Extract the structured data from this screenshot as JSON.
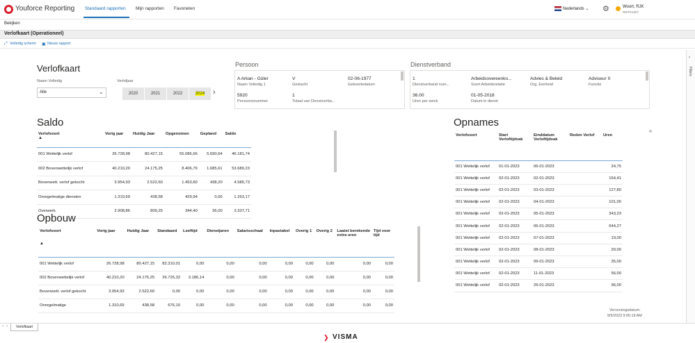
{
  "app": {
    "title": "Youforce Reporting",
    "nav": [
      "Standaard rapporten",
      "Mijn rapporten",
      "Favorieten"
    ],
    "language": "Nederlands",
    "user_name": "Woort, RJK",
    "user_sub": "RWTE1007"
  },
  "menu": {
    "bekijken": "Bekijken"
  },
  "report": {
    "title": "Verlofkaart (Operationeel)",
    "tool_fullscreen": "Volledig scherm",
    "tool_new": "Nieuw rapport",
    "filters": "Filters"
  },
  "verlofkaart": {
    "heading": "Verlofkaart",
    "naam_label": "Naam Volledig",
    "naam_value": "Alle",
    "jaar_label": "Verlofjaar",
    "years": [
      "2020",
      "2021",
      "2022",
      "2024"
    ],
    "selected_year": "2024"
  },
  "persoon": {
    "heading": "Persoon",
    "naam": "A Arkan - Güler",
    "naam_label": "Naam Volledig 1",
    "geslacht": "V",
    "geslacht_label": "Geslacht",
    "geboortedatum": "02-06-1977",
    "geboortedatum_label": "Geboortedatum",
    "persoonsnummer": "5920",
    "persoonsnummer_label": "Persoonsnummer",
    "totaal": "1",
    "totaal_label": "Totaal van Dienstverba..."
  },
  "dienstverband": {
    "heading": "Dienstverband",
    "nummer": "1",
    "nummer_label": "Dienstverband num...",
    "soort": "Arbeidsovereenko...",
    "soort_label": "Soort Arbeidsrelatie",
    "org": "Advies & Beleid",
    "org_label": "Org. Eenheid",
    "functie": "Adviseur II",
    "functie_label": "Functie",
    "uren": "36.00",
    "uren_label": "Uren per week",
    "datum": "01-05-2018",
    "datum_label": "Datum in dienst"
  },
  "saldo": {
    "heading": "Saldo",
    "columns": [
      "Verlofsoort",
      "Vorig jaar",
      "Huidig Jaar",
      "Opgenomen",
      "Gepland",
      "Saldo"
    ],
    "rows": [
      [
        "001 Wettelijk verlof",
        "26.728,98",
        "80.427,15",
        "55.086,66",
        "5.690,64",
        "46.181,74"
      ],
      [
        "002 Bovenwettelijk verlof",
        "40.210,20",
        "24.175,25",
        "8.406,79",
        "1.685,61",
        "53.680,23"
      ],
      [
        "Bovenwett. verlof gekocht",
        "3.954,93",
        "2.522,60",
        "1.453,60",
        "438,20",
        "4.585,73"
      ],
      [
        "Onregelmatige diensten",
        "1.310,69",
        "438,58",
        "429,94",
        "0,00",
        "1.263,17"
      ],
      [
        "Overwerk",
        "2.908,86",
        "809,25",
        "344,40",
        "36,00",
        "3.337,71"
      ]
    ]
  },
  "opbouw": {
    "heading": "Opbouw",
    "columns": [
      "Verlofsoort",
      "Vorig jaar",
      "Huidig Jaar",
      "Standaard",
      "Leeftijd",
      "Dienstjaren",
      "Salarisschaal",
      "Inpastabel",
      "Overig 1",
      "Overig 2",
      "Laatst berekende extra uren",
      "Tijd voor tijd"
    ],
    "rows": [
      [
        "001 Wettelijk verlof",
        "26.728,98",
        "80.427,15",
        "82.310,01",
        "0,00",
        "0,00",
        "0,00",
        "0,00",
        "0,00",
        "0,00",
        "0,00",
        "0,00"
      ],
      [
        "002 Bovenwettelijk verlof",
        "40.210,20",
        "24.175,25",
        "26.725,32",
        "3.186,14",
        "0,00",
        "0,00",
        "0,00",
        "0,00",
        "0,00",
        "0,00",
        "0,00"
      ],
      [
        "Bovenwett. verlof gekocht",
        "3.954,93",
        "2.522,60",
        "0,00",
        "0,00",
        "0,00",
        "0,00",
        "0,00",
        "0,00",
        "0,00",
        "0,00",
        "0,00"
      ],
      [
        "Onregelmatige",
        "1.310,69",
        "438,58",
        "676,10",
        "0,00",
        "0,00",
        "0,00",
        "0,00",
        "0,00",
        "0,00",
        "0,00",
        "0,00"
      ]
    ]
  },
  "opnames": {
    "heading": "Opnames",
    "columns": [
      "Verlofsoort",
      "Start Verloftijdvak",
      "Einddatum Verloftijdvak",
      "Reden Verlof",
      "Uren"
    ],
    "rows": [
      [
        "001 Wettelijk verlof",
        "01-01-2023",
        "06-01-2023",
        "",
        "24,75"
      ],
      [
        "001 Wettelijk verlof",
        "02-01-2023",
        "02-01-2023",
        "",
        "164,41"
      ],
      [
        "001 Wettelijk verlof",
        "02-01-2023",
        "03-01-2023",
        "",
        "127,80"
      ],
      [
        "001 Wettelijk verlof",
        "02-01-2023",
        "04-01-2023",
        "",
        "101,00"
      ],
      [
        "001 Wettelijk verlof",
        "02-01-2023",
        "05-01-2023",
        "",
        "343,23"
      ],
      [
        "001 Wettelijk verlof",
        "02-01-2023",
        "06-01-2023",
        "",
        "644,27"
      ],
      [
        "001 Wettelijk verlof",
        "02-01-2023",
        "07-01-2023",
        "",
        "19,00"
      ],
      [
        "001 Wettelijk verlof",
        "02-01-2023",
        "08-01-2023",
        "",
        "20,00"
      ],
      [
        "001 Wettelijk verlof",
        "02-01-2023",
        "09-01-2023",
        "",
        "35,00"
      ],
      [
        "001 Wettelijk verlof",
        "02-01-2023",
        "11-01-2023",
        "",
        "56,00"
      ],
      [
        "001 Wettelijk verlof",
        "02-01-2023",
        "26-01-2023",
        "",
        "96,00"
      ]
    ],
    "ververs_label": "Verversingsdatum:",
    "ververs_value": "9/5/2023 9:05:19 AM"
  },
  "footer": {
    "page_tab": "Verlofkaart",
    "brand": "VISMA"
  }
}
